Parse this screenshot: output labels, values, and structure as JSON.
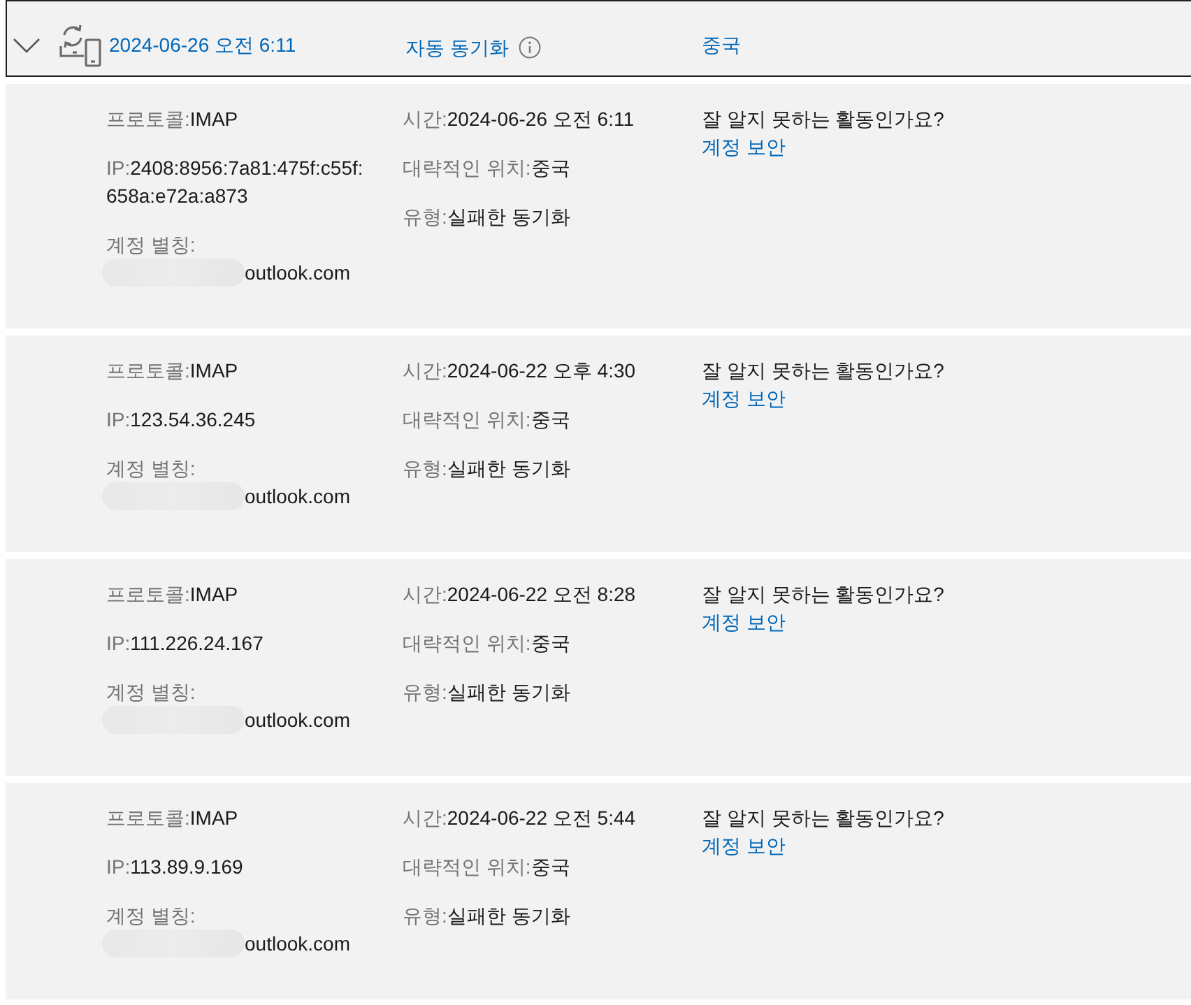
{
  "header": {
    "expanded": true,
    "date": "2024-06-26 오전 6:11",
    "activity": "자동 동기화",
    "location": "중국"
  },
  "events": [
    {
      "protocol": {
        "label": "프로토콜:",
        "value": "IMAP"
      },
      "ip": {
        "label": "IP:",
        "value": "2408:8956:7a81:475f:c55f:658a:e72a:a873"
      },
      "alias": {
        "label": "계정 별칭:",
        "value": "outlook.com"
      },
      "time": {
        "label": "시간:",
        "value": "2024-06-26 오전 6:11"
      },
      "location": {
        "label": "대략적인 위치:",
        "value": "중국"
      },
      "type": {
        "label": "유형:",
        "value": "실패한 동기화"
      },
      "question": "잘 알지 못하는 활동인가요?",
      "link": "계정 보안"
    },
    {
      "protocol": {
        "label": "프로토콜:",
        "value": "IMAP"
      },
      "ip": {
        "label": "IP:",
        "value": "123.54.36.245"
      },
      "alias": {
        "label": "계정 별칭:",
        "value": "outlook.com"
      },
      "time": {
        "label": "시간:",
        "value": "2024-06-22 오후 4:30"
      },
      "location": {
        "label": "대략적인 위치:",
        "value": "중국"
      },
      "type": {
        "label": "유형:",
        "value": "실패한 동기화"
      },
      "question": "잘 알지 못하는 활동인가요?",
      "link": "계정 보안"
    },
    {
      "protocol": {
        "label": "프로토콜:",
        "value": "IMAP"
      },
      "ip": {
        "label": "IP:",
        "value": "111.226.24.167"
      },
      "alias": {
        "label": "계정 별칭:",
        "value": "outlook.com"
      },
      "time": {
        "label": "시간:",
        "value": "2024-06-22 오전 8:28"
      },
      "location": {
        "label": "대략적인 위치:",
        "value": "중국"
      },
      "type": {
        "label": "유형:",
        "value": "실패한 동기화"
      },
      "question": "잘 알지 못하는 활동인가요?",
      "link": "계정 보안"
    },
    {
      "protocol": {
        "label": "프로토콜:",
        "value": "IMAP"
      },
      "ip": {
        "label": "IP:",
        "value": "113.89.9.169"
      },
      "alias": {
        "label": "계정 별칭:",
        "value": "outlook.com"
      },
      "time": {
        "label": "시간:",
        "value": "2024-06-22 오전 5:44"
      },
      "location": {
        "label": "대략적인 위치:",
        "value": "중국"
      },
      "type": {
        "label": "유형:",
        "value": "실패한 동기화"
      },
      "question": "잘 알지 못하는 활동인가요?",
      "link": "계정 보안"
    }
  ]
}
